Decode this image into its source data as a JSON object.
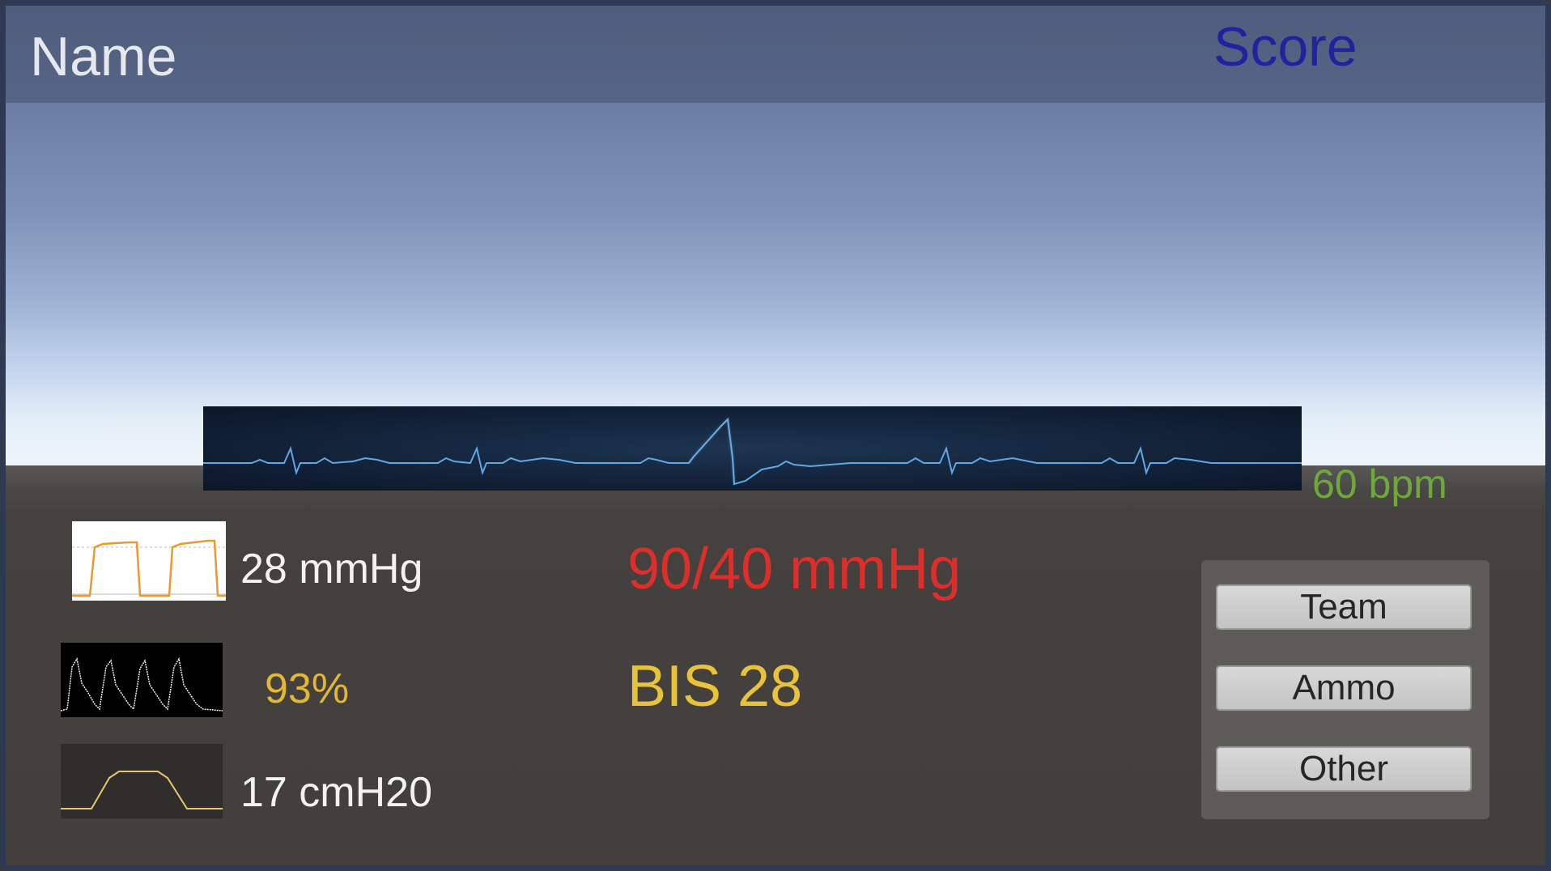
{
  "hud": {
    "name_label": "Name",
    "score_label": "Score"
  },
  "monitor": {
    "heart_rate": "60 bpm",
    "etco2": "28 mmHg",
    "spo2": "93%",
    "airway_pressure": "17 cmH20",
    "blood_pressure": "90/40 mmHg",
    "bis": "BIS 28"
  },
  "menu": {
    "team": "Team",
    "ammo": "Ammo",
    "other": "Other"
  },
  "colors": {
    "heart_rate": "#6fa83a",
    "blood_pressure": "#dc2e2a",
    "spo2": "#e3b634",
    "bis": "#e7c23a",
    "score": "#22229e"
  }
}
